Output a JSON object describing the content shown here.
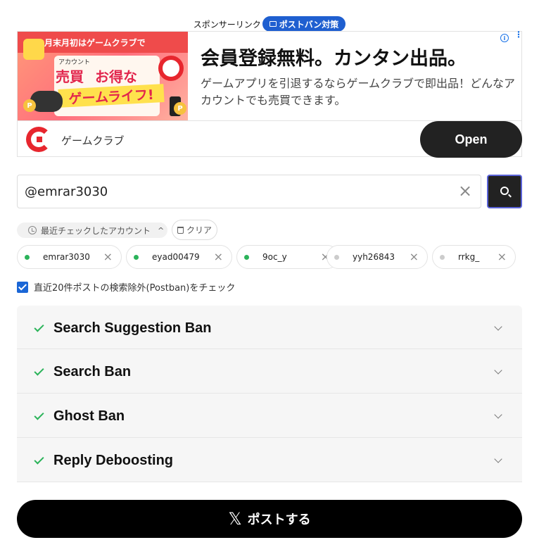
{
  "sponsor": {
    "label": "スポンサーリンク",
    "badge": "ポストバン対策"
  },
  "ad": {
    "banner_top": "月末月初はゲームクラブで",
    "banner_small": "アカウント",
    "banner_big1": "売買",
    "banner_big2": "お得な",
    "banner_stripe": "ゲームライフ!",
    "title": "会員登録無料。カンタン出品。",
    "description": "ゲームアプリを引退するならゲームクラブで即出品！どんなアカウントでも売買できます。",
    "brand": "ゲームクラブ",
    "open_label": "Open",
    "info_glyph": "i",
    "more_glyph": "⋮",
    "coin_glyph": "P"
  },
  "search": {
    "value": "@emrar3030",
    "clear_glyph": "×"
  },
  "recent": {
    "toggle_label": "最近チェックしたアカウント",
    "caret": "^",
    "clear_label": "クリア"
  },
  "chips": [
    {
      "label": "emrar3030",
      "status_color": "#2bb35a",
      "x": "×"
    },
    {
      "label": "eyad00479",
      "status_color": "#2bb35a",
      "x": "×"
    },
    {
      "label": "9oc_y",
      "status_color": "#2bb35a",
      "x": "×"
    },
    {
      "label": "yyh26843",
      "status_color": "#cccccc",
      "x": "×"
    },
    {
      "label": "rrkg_",
      "status_color": "#cccccc",
      "x": "×"
    }
  ],
  "postban_check": {
    "label": "直近20件ポストの検索除外(Postban)をチェック",
    "checked": true
  },
  "checks": [
    {
      "label": "Search Suggestion Ban",
      "status": "ok"
    },
    {
      "label": "Search Ban",
      "status": "ok"
    },
    {
      "label": "Ghost Ban",
      "status": "ok"
    },
    {
      "label": "Reply Deboosting",
      "status": "ok"
    }
  ],
  "post_button": {
    "icon": "𝕏",
    "label": "ポストする"
  },
  "colors": {
    "accent": "#1f5fd0",
    "ok": "#2bb35a",
    "dark": "#222222"
  }
}
